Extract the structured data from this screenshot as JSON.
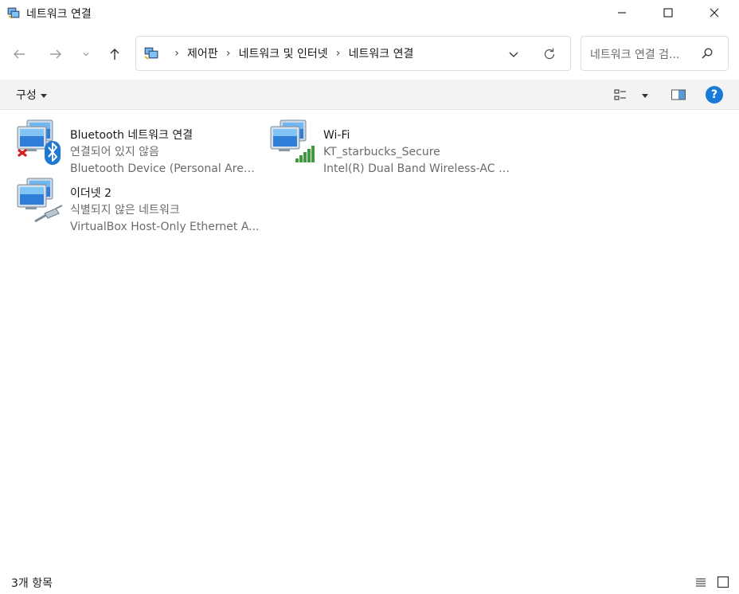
{
  "window": {
    "title": "네트워크 연결",
    "minimize_icon": "minimize-icon",
    "maximize_icon": "maximize-icon",
    "close_icon": "close-icon"
  },
  "navigation": {
    "back_icon": "arrow-left-icon",
    "forward_icon": "arrow-right-icon",
    "recent_icon": "chevron-down-icon",
    "up_icon": "arrow-up-icon"
  },
  "address": {
    "breadcrumbs": [
      "제어판",
      "네트워크 및 인터넷",
      "네트워크 연결"
    ],
    "separator": "›"
  },
  "search": {
    "placeholder": "네트워크 연결 검..."
  },
  "commandbar": {
    "organize_label": "구성",
    "help_label": "?"
  },
  "connections": [
    {
      "name": "Bluetooth 네트워크 연결",
      "status": "연결되어 있지 않음",
      "device": "Bluetooth Device (Personal Area ...",
      "icon": "bluetooth-network-icon",
      "overlay": "disconnected-x-icon"
    },
    {
      "name": "Wi-Fi",
      "status": "KT_starbucks_Secure",
      "device": "Intel(R) Dual Band Wireless-AC 8...",
      "icon": "wifi-network-icon",
      "overlay": "signal-bars-icon"
    },
    {
      "name": "이더넷 2",
      "status": "식별되지 않은 네트워크",
      "device": "VirtualBox Host-Only Ethernet A...",
      "icon": "ethernet-network-icon",
      "overlay": "ethernet-cable-icon"
    }
  ],
  "statusbar": {
    "item_count": "3개 항목"
  },
  "colors": {
    "accent": "#1a7ad8",
    "commandbar_bg": "#f3f3f3",
    "secondary_text": "#6b6b6b",
    "error_red": "#d32020",
    "signal_green": "#3f9a3f"
  }
}
